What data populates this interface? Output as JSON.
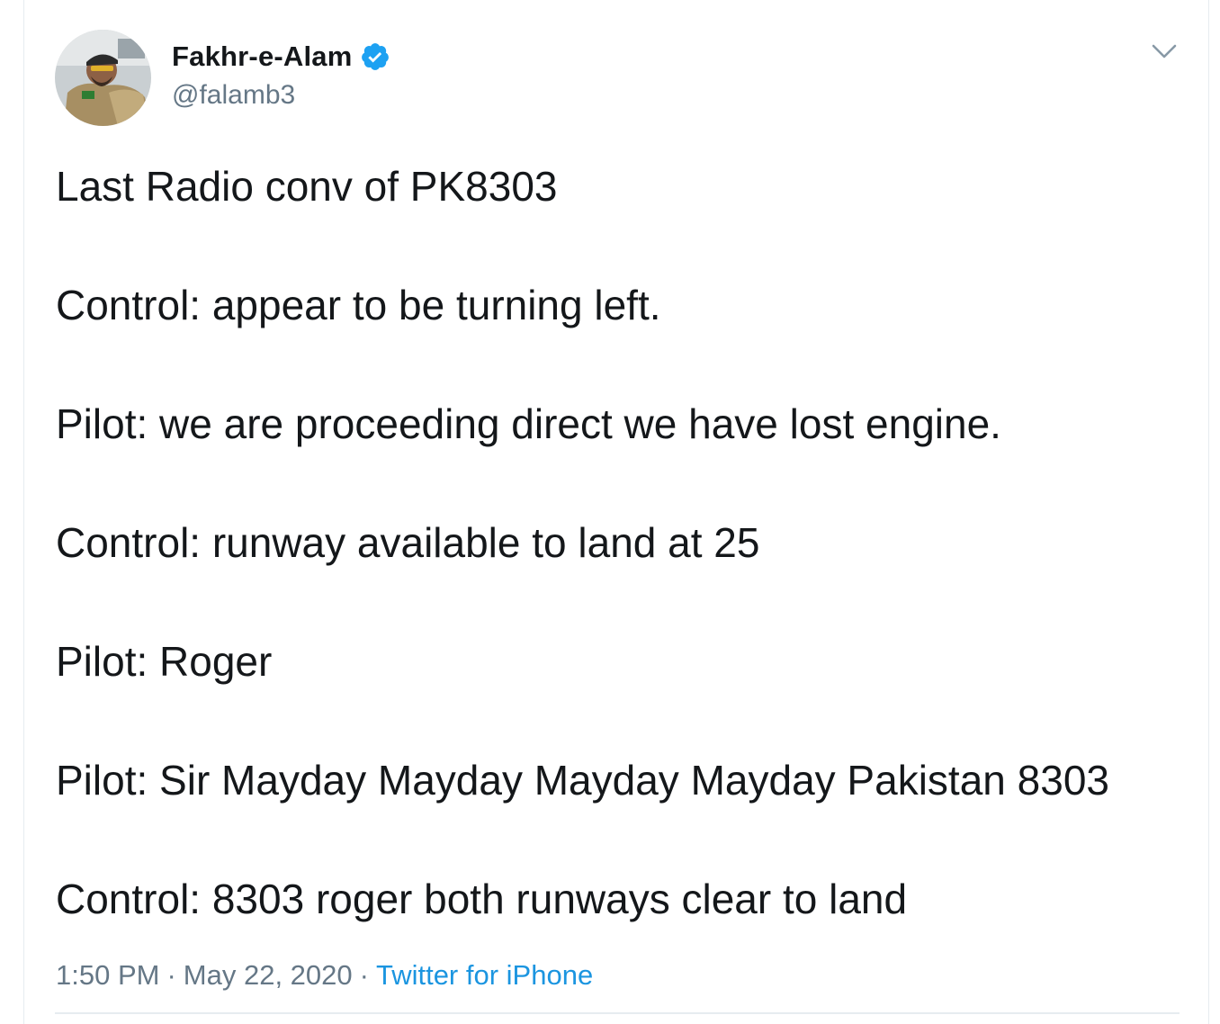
{
  "tweet": {
    "author": {
      "display_name": "Fakhr-e-Alam",
      "handle": "@falamb3",
      "verified": true,
      "avatar_icon": "profile-photo"
    },
    "menu_icon": "chevron-down-icon",
    "lines": [
      "Last Radio conv of PK8303",
      "Control: appear to be turning left.",
      "Pilot: we are proceeding direct we have lost engine.",
      "Control: runway available to land at 25",
      "Pilot: Roger",
      "Pilot: Sir Mayday Mayday Mayday Mayday Pakistan 8303",
      "Control: 8303 roger both runways clear to land"
    ],
    "time": "1:50 PM",
    "separator": "·",
    "date": "May 22, 2020",
    "source": "Twitter for iPhone"
  },
  "colors": {
    "text_primary": "#14171a",
    "text_secondary": "#657786",
    "link": "#1b95e0",
    "verified_badge": "#1da1f2",
    "border": "#e6ecf0"
  }
}
